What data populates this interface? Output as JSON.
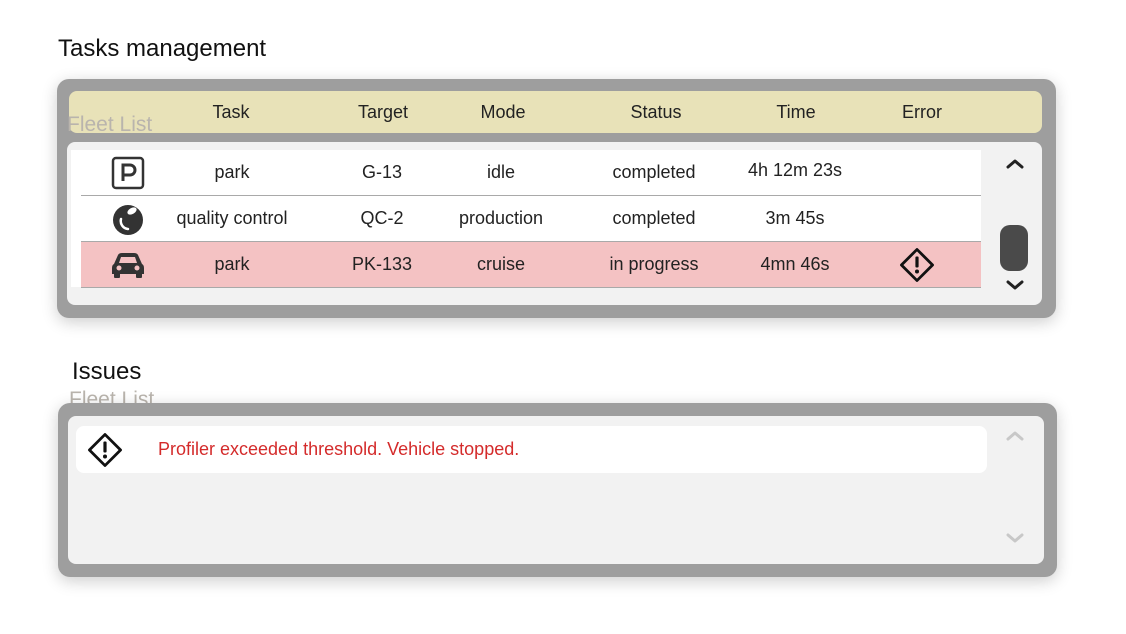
{
  "tasks": {
    "title": "Tasks management",
    "ghost_label": "Fleet List",
    "columns": [
      "Task",
      "Target",
      "Mode",
      "Status",
      "Time",
      "Error"
    ],
    "rows": [
      {
        "icon": "parking-icon",
        "task": "park",
        "target": "G-13",
        "mode": "idle",
        "status": "completed",
        "time": "4h 12m 23s",
        "error": false
      },
      {
        "icon": "apple-icon",
        "task": "quality control",
        "target": "QC-2",
        "mode": "production",
        "status": "completed",
        "time": "3m 45s",
        "error": false
      },
      {
        "icon": "car-icon",
        "task": "park",
        "target": "PK-133",
        "mode": "cruise",
        "status": "in progress",
        "time": "4mn 46s",
        "error": true
      }
    ]
  },
  "issues": {
    "title": "Issues",
    "ghost_label": "Fleet List",
    "items": [
      {
        "icon": "warning-icon",
        "message": "Profiler exceeded threshold. Vehicle stopped."
      }
    ]
  },
  "colors": {
    "header": "#e8e2b8",
    "error_row": "#f4c2c3",
    "error_text": "#d42b2b",
    "panel": "#9e9e9e"
  }
}
